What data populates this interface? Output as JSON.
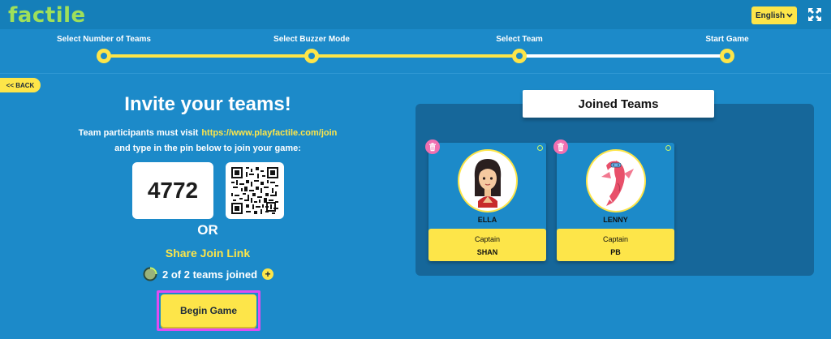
{
  "app": {
    "logo": "factile"
  },
  "header": {
    "language": "English"
  },
  "steps": [
    {
      "label": "Select Number of Teams"
    },
    {
      "label": "Select Buzzer Mode"
    },
    {
      "label": "Select Team"
    },
    {
      "label": "Start Game"
    }
  ],
  "nav": {
    "back_label": "<< BACK"
  },
  "invite": {
    "title": "Invite your teams!",
    "instruction_prefix": "Team participants must visit",
    "join_url": "https://www.playfactile.com/join",
    "instruction_suffix": "and type in the pin below to join your game:",
    "pin": "4772",
    "or_label": "OR",
    "share_link_label": "Share Join Link",
    "teams_joined": "2 of 2 teams joined",
    "begin_label": "Begin Game"
  },
  "joined": {
    "title": "Joined Teams",
    "teams": [
      {
        "name": "ELLA",
        "captain_label": "Captain",
        "captain_name": "SHAN",
        "avatar_icon": "girl-avatar-icon"
      },
      {
        "name": "LENNY",
        "captain_label": "Captain",
        "captain_name": "PB",
        "avatar_icon": "fish-avatar-icon"
      }
    ]
  },
  "colors": {
    "background": "#1c8ac9",
    "topbar": "#157fb9",
    "accent_yellow": "#fde549",
    "logo_green": "#9fe05a",
    "panel": "#16679a",
    "highlight_magenta": "#e04cf2",
    "trash_pink": "#f06fb0"
  }
}
